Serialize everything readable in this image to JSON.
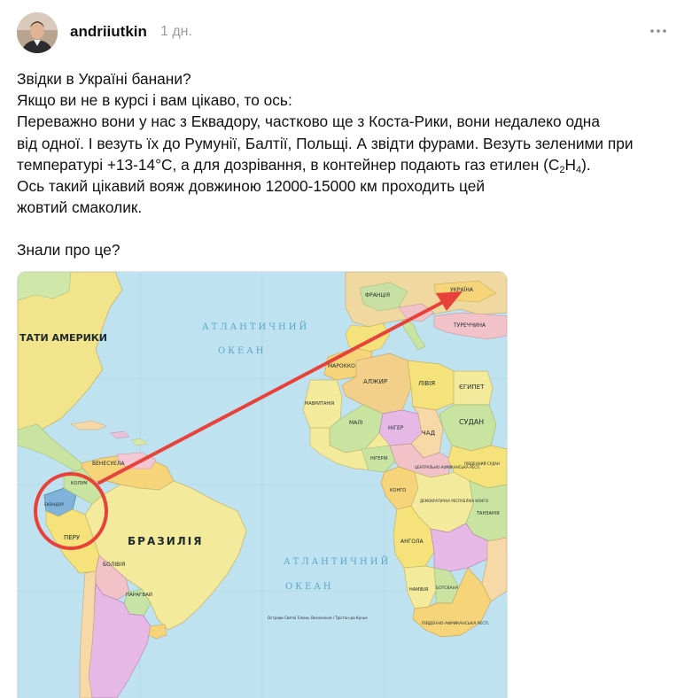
{
  "post": {
    "username": "andriiutkin",
    "timestamp": "1 дн.",
    "lines": [
      "Звідки в Україні банани?",
      "Якщо ви не в курсі і вам цікаво, то ось:",
      "Переважно вони у нас з Еквадору, частково ще з Коста-Рики, вони недалеко одна",
      "від одної. І везуть їх до Румунії, Балтії, Польщі. А звідти фурами. Везуть зеленими при",
      "Ось такий цікавий вояж довжиною 12000-15000 км проходить цей",
      "жовтий смаколик."
    ],
    "temp_line": {
      "before": "температурі  +13-14°C, а для дозрівання, в контейнер подають газ етилен (C",
      "sub1": "2",
      "mid": "H",
      "sub2": "4",
      "after": ")."
    },
    "question": "Знали про це?"
  },
  "icons": {
    "more": "more-dots-icon",
    "arrow": "route-arrow-icon"
  },
  "colors": {
    "arrow": "#e8413a",
    "ocean": "#bfe2f0",
    "ocean_text": "#57a8c8"
  },
  "map": {
    "ocean_labels": {
      "atlantic_north_1": "АТЛАНТИЧНИЙ",
      "atlantic_north_2": "ОКЕАН",
      "atlantic_south_1": "АТЛАНТИЧНИЙ",
      "atlantic_south_2": "ОКЕАН"
    },
    "countries": {
      "usa": "ТАТИ АМЕРИКИ",
      "brazil": "БРАЗИЛІЯ",
      "peru": "ПЕРУ",
      "ecuador": "ЕКВАДОР",
      "bolivia": "БОЛІВІЯ",
      "venezuela": "ВЕНЕСУЕЛА",
      "colombia": "КОЛУМ",
      "paraguay": "ПАРАГВАЙ",
      "ukraine": "УКРАЇНА",
      "france": "ФРАНЦІЯ",
      "turkey": "ТУРЕЧЧИНА",
      "morocco": "МАРОККО",
      "algeria": "АЛЖИР",
      "libya": "ЛІВІЯ",
      "egypt": "ЄГИПЕТ",
      "sudan": "СУДАН",
      "chad": "ЧАД",
      "niger": "НІГЕР",
      "mali": "МАЛІ",
      "mauritania": "МАВРИТАНІЯ",
      "nigeria": "НІГЕРІЯ",
      "car": "ЦЕНТРАЛЬНО-АФРИКАНСЬКА РЕСП.",
      "drc": "ДЕМОКРАТИЧНА РЕСПУБЛІКА КОНГО",
      "congo": "КОНГО",
      "south_sudan": "ПІВДЕННИЙ СУДАН",
      "tanzania": "ТАНЗАНІЯ",
      "angola": "АНГОЛА",
      "namibia": "НАМІБІЯ",
      "botswana": "БОТСВАНА",
      "south_africa": "ПІВДЕННО-АФРИКАНСЬКА РЕСП.",
      "saint_helena": "Острови Святої Єлени, Вознесіння і Трістан-да-Кунья"
    }
  }
}
